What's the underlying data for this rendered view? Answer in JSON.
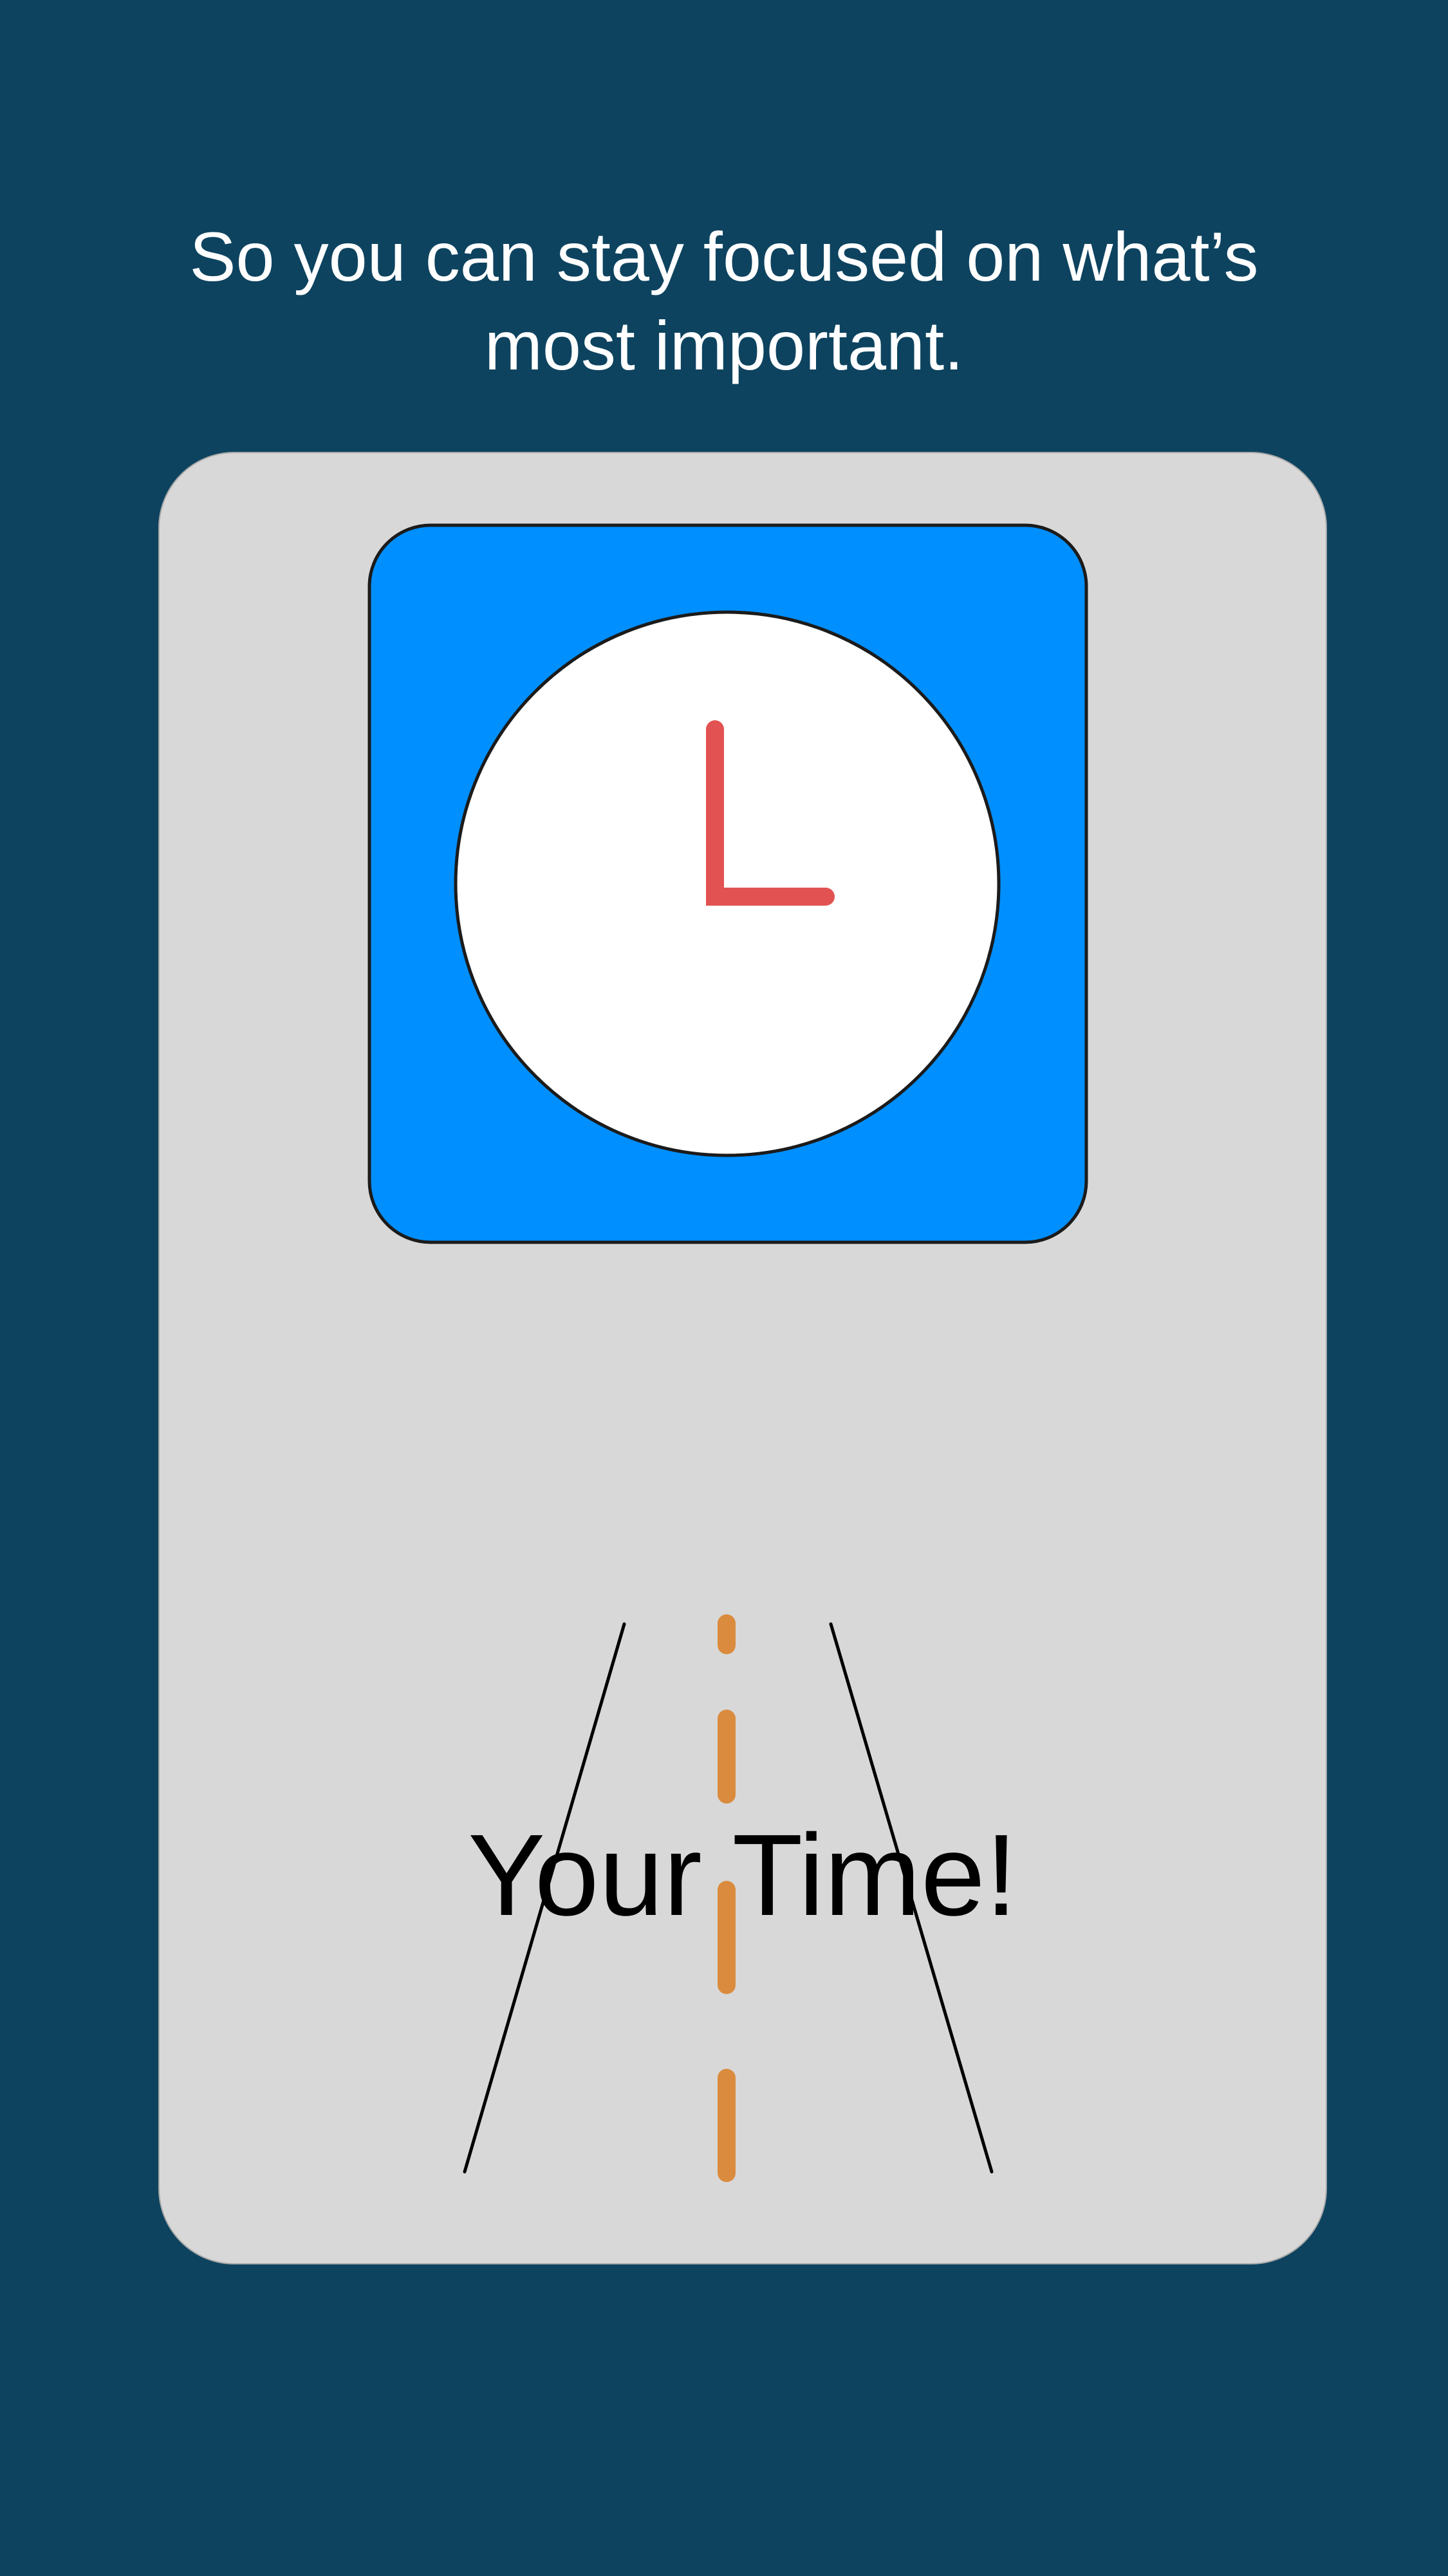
{
  "headline": "So you can stay focused on what’s most important.",
  "card": {
    "title": "Your Time!",
    "icons": {
      "clock": "clock-icon",
      "road": "road-icon"
    }
  },
  "colors": {
    "background": "#0d435f",
    "card": "#d8d8d8",
    "clock_tile": "#008ffe",
    "clock_face": "#ffffff",
    "clock_hands": "#e25252",
    "road_center_line": "#db8b3d",
    "road_edges": "#000000"
  }
}
